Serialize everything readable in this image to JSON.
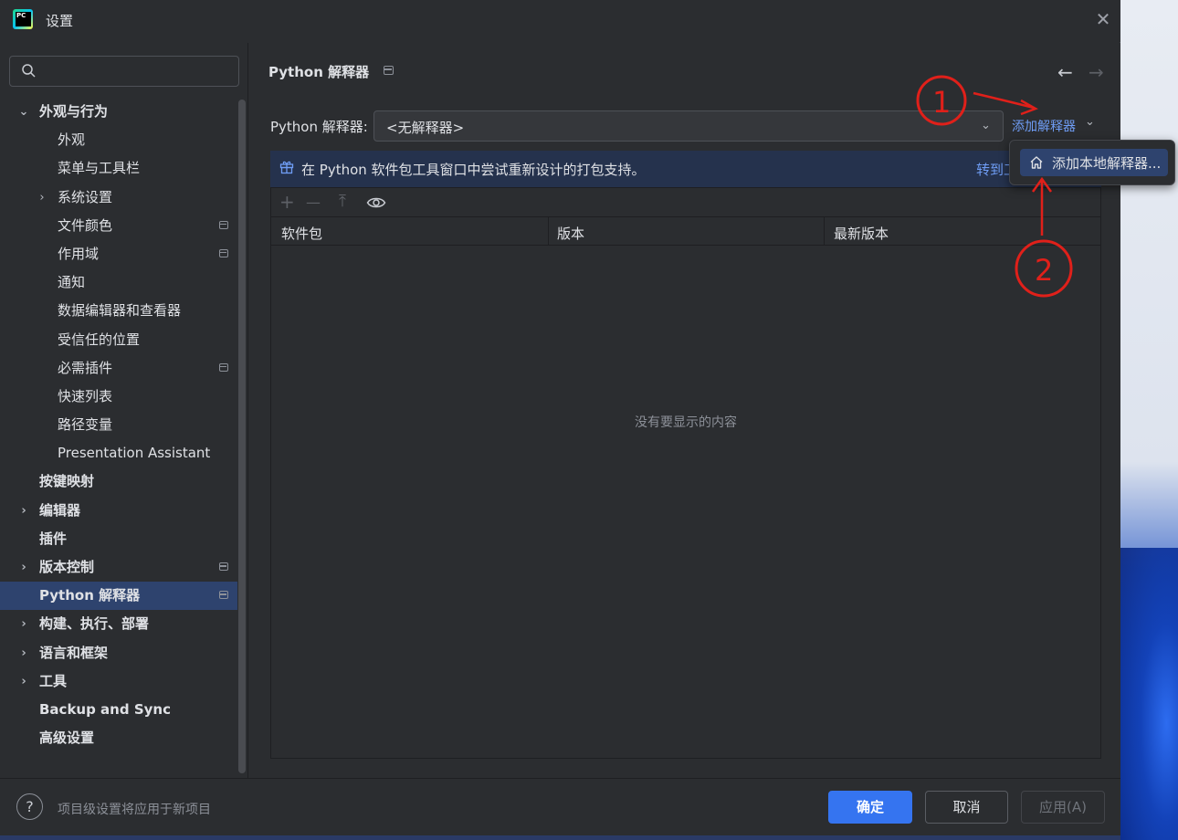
{
  "window": {
    "title": "设置",
    "close_glyph": "✕"
  },
  "sidebar": {
    "search_placeholder": "",
    "items": [
      {
        "label": "外观与行为",
        "arrow": "⌄",
        "bold": true,
        "indent": 0,
        "project": false
      },
      {
        "label": "外观",
        "arrow": "",
        "bold": false,
        "indent": 2,
        "project": false
      },
      {
        "label": "菜单与工具栏",
        "arrow": "",
        "bold": false,
        "indent": 2,
        "project": false
      },
      {
        "label": "系统设置",
        "arrow": "›",
        "bold": false,
        "indent": 1,
        "project": false
      },
      {
        "label": "文件颜色",
        "arrow": "",
        "bold": false,
        "indent": 2,
        "project": true
      },
      {
        "label": "作用域",
        "arrow": "",
        "bold": false,
        "indent": 2,
        "project": true
      },
      {
        "label": "通知",
        "arrow": "",
        "bold": false,
        "indent": 2,
        "project": false
      },
      {
        "label": "数据编辑器和查看器",
        "arrow": "",
        "bold": false,
        "indent": 2,
        "project": false
      },
      {
        "label": "受信任的位置",
        "arrow": "",
        "bold": false,
        "indent": 2,
        "project": false
      },
      {
        "label": "必需插件",
        "arrow": "",
        "bold": false,
        "indent": 2,
        "project": true
      },
      {
        "label": "快速列表",
        "arrow": "",
        "bold": false,
        "indent": 2,
        "project": false
      },
      {
        "label": "路径变量",
        "arrow": "",
        "bold": false,
        "indent": 2,
        "project": false
      },
      {
        "label": "Presentation Assistant",
        "arrow": "",
        "bold": false,
        "indent": 2,
        "project": false
      },
      {
        "label": "按键映射",
        "arrow": "",
        "bold": true,
        "indent": 0,
        "project": false
      },
      {
        "label": "编辑器",
        "arrow": "›",
        "bold": true,
        "indent": 0,
        "project": false
      },
      {
        "label": "插件",
        "arrow": "",
        "bold": true,
        "indent": 0,
        "project": false
      },
      {
        "label": "版本控制",
        "arrow": "›",
        "bold": true,
        "indent": 0,
        "project": true
      },
      {
        "label": "Python 解释器",
        "arrow": "",
        "bold": true,
        "indent": 0,
        "project": true,
        "selected": true
      },
      {
        "label": "构建、执行、部署",
        "arrow": "›",
        "bold": true,
        "indent": 0,
        "project": false
      },
      {
        "label": "语言和框架",
        "arrow": "›",
        "bold": true,
        "indent": 0,
        "project": false
      },
      {
        "label": "工具",
        "arrow": "›",
        "bold": true,
        "indent": 0,
        "project": false
      },
      {
        "label": "Backup and Sync",
        "arrow": "",
        "bold": true,
        "indent": 0,
        "project": false
      },
      {
        "label": "高级设置",
        "arrow": "",
        "bold": true,
        "indent": 0,
        "project": false
      }
    ]
  },
  "main": {
    "title": "Python 解释器",
    "back_glyph": "←",
    "forward_glyph": "→",
    "interpreter_label": "Python 解释器:",
    "interpreter_value": "<无解释器>",
    "dropdown_chevron": "⌄",
    "add_interpreter_label": "添加解释器",
    "banner_text": "在 Python 软件包工具窗口中尝试重新设计的打包支持。",
    "banner_link": "转到工",
    "toolbar": {
      "add_glyph": "+",
      "remove_glyph": "—",
      "upgrade_glyph": "⤒"
    },
    "columns": [
      "软件包",
      "版本",
      "最新版本"
    ],
    "empty_text": "没有要显示的内容"
  },
  "popup": {
    "item_label": "添加本地解释器..."
  },
  "footer": {
    "help_glyph": "?",
    "note": "项目级设置将应用于新项目",
    "ok_label": "确定",
    "cancel_label": "取消",
    "apply_label": "应用(A)"
  },
  "annotations": {
    "step1": "1",
    "step2": "2",
    "color": "#e0201a"
  },
  "colors": {
    "accent": "#3574f0",
    "link": "#6f9df5",
    "selection": "#2e436e",
    "background": "#2b2d30"
  }
}
